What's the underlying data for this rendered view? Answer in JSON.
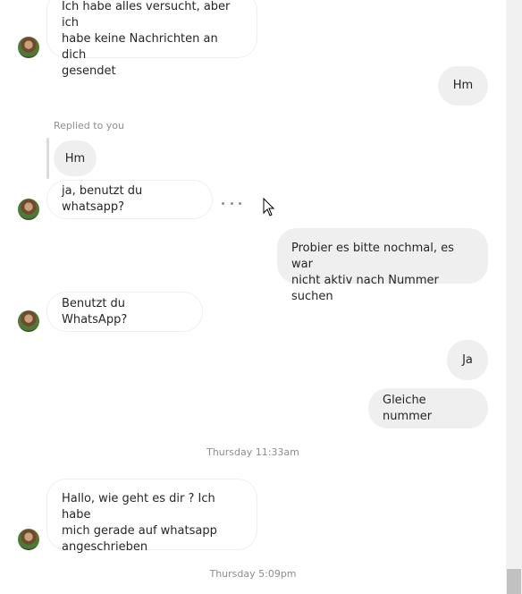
{
  "messages": {
    "m1": "Ich habe alles versucht, aber ich\nhabe keine Nachrichten an dich\ngesendet",
    "m2": "Hm",
    "reply_label": "Replied to you",
    "quoted": "Hm",
    "m3": "ja, benutzt du whatsapp?",
    "m4": "Probier es bitte nochmal, es war\nnicht aktiv nach Nummer suchen",
    "m5": "Benutzt du WhatsApp?",
    "m6": "Ja",
    "m7": "Gleiche nummer",
    "m8": "Hallo, wie geht es dir ? Ich habe\nmich gerade auf whatsapp\nangeschrieben"
  },
  "timestamps": {
    "t1": "Thursday 11:33am",
    "t2": "Thursday 5:09pm"
  },
  "icons": {
    "more": "more-options-icon",
    "cursor": "mouse-cursor-icon",
    "avatar": "contact-avatar"
  },
  "colors": {
    "outgoing_bubble": "#efefef",
    "incoming_border": "#efefef",
    "meta_text": "#8e8e8e"
  }
}
